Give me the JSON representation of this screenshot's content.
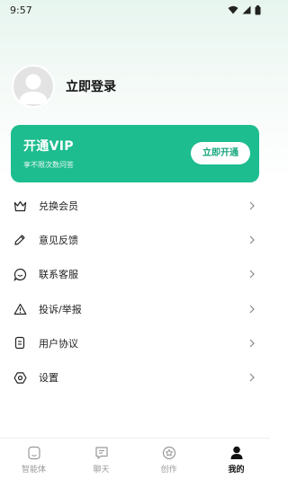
{
  "status_bar": {
    "time": "9:57"
  },
  "profile": {
    "login_label": "立即登录"
  },
  "vip": {
    "title": "开通VIP",
    "subtitle": "享不限次数问答",
    "button_label": "立即开通",
    "color": "#1dbd8f"
  },
  "menu": {
    "items": [
      {
        "label": "兑换会员",
        "icon": "crown-icon"
      },
      {
        "label": "意见反馈",
        "icon": "pencil-icon"
      },
      {
        "label": "联系客服",
        "icon": "chat-bubble-icon"
      },
      {
        "label": "投诉/举报",
        "icon": "warning-icon"
      },
      {
        "label": "用户协议",
        "icon": "document-icon"
      },
      {
        "label": "设置",
        "icon": "settings-icon"
      }
    ]
  },
  "tabbar": {
    "tabs": [
      {
        "label": "智能体",
        "icon": "agent-icon",
        "active": false
      },
      {
        "label": "聊天",
        "icon": "chat-icon",
        "active": false
      },
      {
        "label": "创作",
        "icon": "create-icon",
        "active": false
      },
      {
        "label": "我的",
        "icon": "user-icon",
        "active": true
      }
    ]
  }
}
